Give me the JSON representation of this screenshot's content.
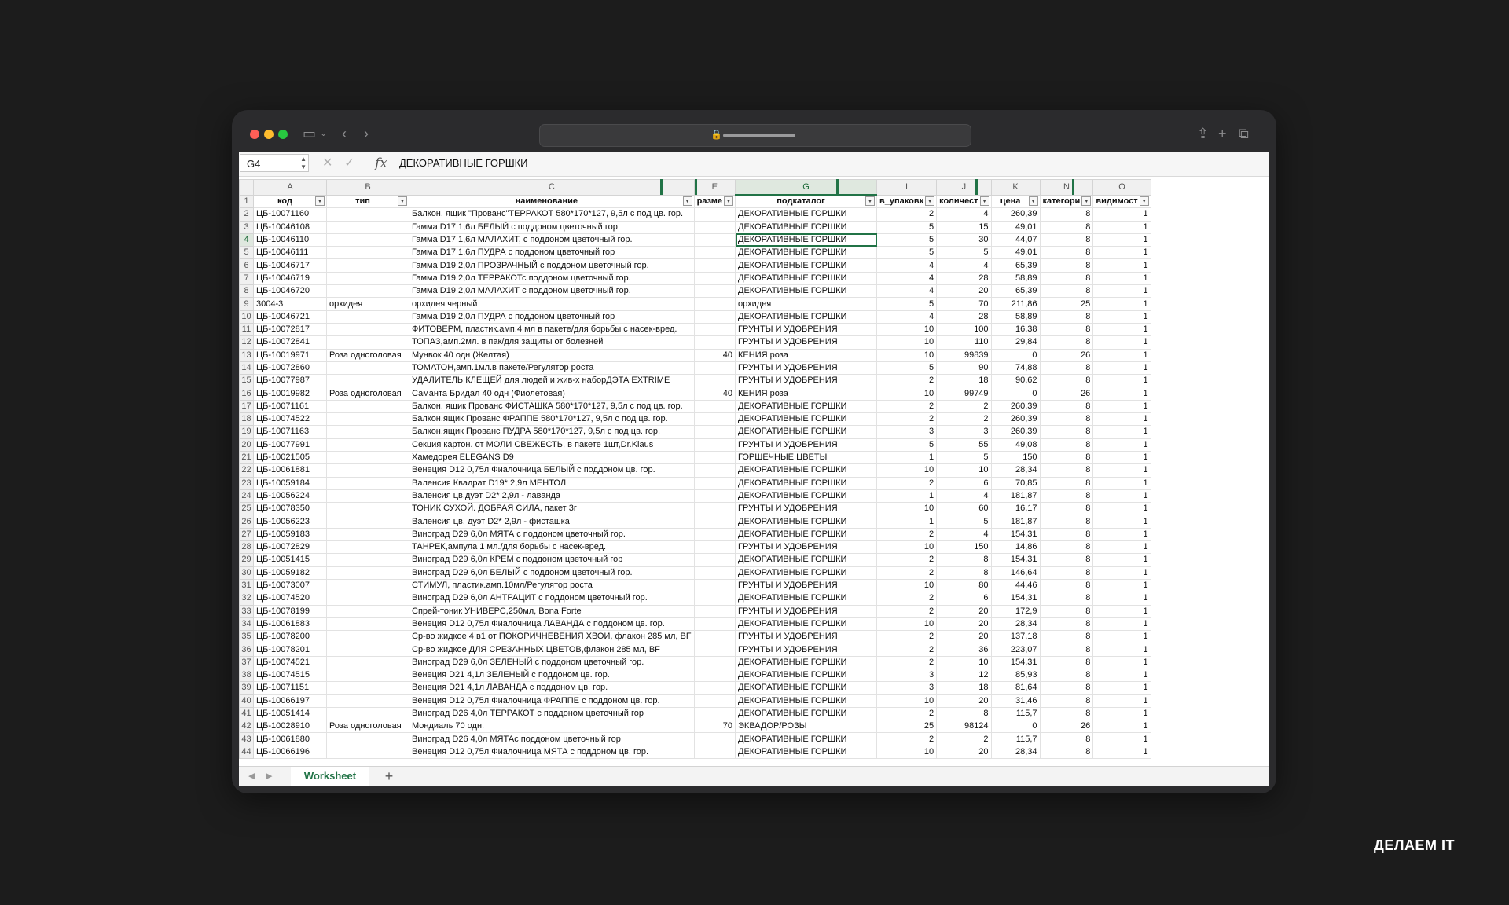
{
  "browser": {
    "icons": [
      "sidebar-icon",
      "chevron-down-icon",
      "back-icon",
      "forward-icon",
      "lock-icon",
      "share-icon",
      "new-tab-icon",
      "tabs-overview-icon"
    ]
  },
  "formula_bar": {
    "cell_ref": "G4",
    "fx_label": "fx",
    "value": "ДЕКОРАТИВНЫЕ ГОРШКИ"
  },
  "sheet": {
    "columns": [
      "A",
      "B",
      "C",
      "E",
      "G",
      "I",
      "J",
      "K",
      "N",
      "O"
    ],
    "headers": [
      "код",
      "тип",
      "наименование",
      "разме",
      "подкаталог",
      "в_упаковк",
      "количест",
      "цена",
      "категори",
      "видимост"
    ],
    "rows": [
      [
        "2",
        "ЦБ-10071160",
        "",
        "Балкон. ящик \"Прованс\"ТЕРРАКОТ 580*170*127, 9,5л с под цв. гор.",
        "",
        "ДЕКОРАТИВНЫЕ ГОРШКИ",
        "2",
        "4",
        "260,39",
        "8",
        "1"
      ],
      [
        "3",
        "ЦБ-10046108",
        "",
        "Гамма D17 1,6л БЕЛЫЙ с поддоном цветочный гор",
        "",
        "ДЕКОРАТИВНЫЕ ГОРШКИ",
        "5",
        "15",
        "49,01",
        "8",
        "1"
      ],
      [
        "4",
        "ЦБ-10046110",
        "",
        "Гамма D17 1,6л МАЛАХИТ, с поддоном цветочный гор.",
        "",
        "ДЕКОРАТИВНЫЕ ГОРШКИ",
        "5",
        "30",
        "44,07",
        "8",
        "1"
      ],
      [
        "5",
        "ЦБ-10046111",
        "",
        "Гамма D17 1,6л ПУДРА с поддоном цветочный гор",
        "",
        "ДЕКОРАТИВНЫЕ ГОРШКИ",
        "5",
        "5",
        "49,01",
        "8",
        "1"
      ],
      [
        "6",
        "ЦБ-10046717",
        "",
        "Гамма D19 2,0л ПРОЗРАЧНЫЙ с поддоном цветочный гор.",
        "",
        "ДЕКОРАТИВНЫЕ ГОРШКИ",
        "4",
        "4",
        "65,39",
        "8",
        "1"
      ],
      [
        "7",
        "ЦБ-10046719",
        "",
        "Гамма D19 2,0л ТЕРРАКОТс поддоном цветочный гор.",
        "",
        "ДЕКОРАТИВНЫЕ ГОРШКИ",
        "4",
        "28",
        "58,89",
        "8",
        "1"
      ],
      [
        "8",
        "ЦБ-10046720",
        "",
        "Гамма D19 2,0л МАЛАХИТ с поддоном цветочный гор.",
        "",
        "ДЕКОРАТИВНЫЕ ГОРШКИ",
        "4",
        "20",
        "65,39",
        "8",
        "1"
      ],
      [
        "9",
        "3004-3",
        "орхидея",
        "орхидея черный",
        "",
        "орхидея",
        "5",
        "70",
        "211,86",
        "25",
        "1"
      ],
      [
        "10",
        "ЦБ-10046721",
        "",
        "Гамма D19 2,0л ПУДРА с поддоном цветочный гор",
        "",
        "ДЕКОРАТИВНЫЕ ГОРШКИ",
        "4",
        "28",
        "58,89",
        "8",
        "1"
      ],
      [
        "11",
        "ЦБ-10072817",
        "",
        "ФИТОВЕРМ, пластик.амп.4 мл в пакете/для борьбы с насек-вред.",
        "",
        "ГРУНТЫ И УДОБРЕНИЯ",
        "10",
        "100",
        "16,38",
        "8",
        "1"
      ],
      [
        "12",
        "ЦБ-10072841",
        "",
        "ТОПАЗ,амп.2мл. в пак/для защиты от болезней",
        "",
        "ГРУНТЫ И УДОБРЕНИЯ",
        "10",
        "110",
        "29,84",
        "8",
        "1"
      ],
      [
        "13",
        "ЦБ-10019971",
        "Роза одноголовая",
        "Мунвок 40 одн (Желтая)",
        "40",
        "КЕНИЯ роза",
        "10",
        "99839",
        "0",
        "26",
        "1"
      ],
      [
        "14",
        "ЦБ-10072860",
        "",
        "ТОМАТОН,амп.1мл.в пакете/Регулятор роста",
        "",
        "ГРУНТЫ И УДОБРЕНИЯ",
        "5",
        "90",
        "74,88",
        "8",
        "1"
      ],
      [
        "15",
        "ЦБ-10077987",
        "",
        "УДАЛИТЕЛЬ КЛЕЩЕЙ для людей и жив-х наборДЭТА EXTRIME",
        "",
        "ГРУНТЫ И УДОБРЕНИЯ",
        "2",
        "18",
        "90,62",
        "8",
        "1"
      ],
      [
        "16",
        "ЦБ-10019982",
        "Роза одноголовая",
        "Саманта Бридал 40 одн (Фиолетовая)",
        "40",
        "КЕНИЯ роза",
        "10",
        "99749",
        "0",
        "26",
        "1"
      ],
      [
        "17",
        "ЦБ-10071161",
        "",
        "Балкон. ящик Прованс ФИСТАШКА 580*170*127, 9,5л с под цв. гор.",
        "",
        "ДЕКОРАТИВНЫЕ ГОРШКИ",
        "2",
        "2",
        "260,39",
        "8",
        "1"
      ],
      [
        "18",
        "ЦБ-10074522",
        "",
        "Балкон.ящик Прованс ФРАППЕ 580*170*127, 9,5л с под цв. гор.",
        "",
        "ДЕКОРАТИВНЫЕ ГОРШКИ",
        "2",
        "2",
        "260,39",
        "8",
        "1"
      ],
      [
        "19",
        "ЦБ-10071163",
        "",
        "Балкон.ящик Прованс ПУДРА 580*170*127, 9,5л с под цв. гор.",
        "",
        "ДЕКОРАТИВНЫЕ ГОРШКИ",
        "3",
        "3",
        "260,39",
        "8",
        "1"
      ],
      [
        "20",
        "ЦБ-10077991",
        "",
        "Секция картон. от МОЛИ СВЕЖЕСТЬ, в пакете 1шт,Dr.Klaus",
        "",
        "ГРУНТЫ И УДОБРЕНИЯ",
        "5",
        "55",
        "49,08",
        "8",
        "1"
      ],
      [
        "21",
        "ЦБ-10021505",
        "",
        "Хамедорея ELEGANS D9",
        "",
        "ГОРШЕЧНЫЕ ЦВЕТЫ",
        "1",
        "5",
        "150",
        "8",
        "1"
      ],
      [
        "22",
        "ЦБ-10061881",
        "",
        "Венеция D12 0,75л Фиалочница БЕЛЫЙ с поддоном цв. гор.",
        "",
        "ДЕКОРАТИВНЫЕ ГОРШКИ",
        "10",
        "10",
        "28,34",
        "8",
        "1"
      ],
      [
        "23",
        "ЦБ-10059184",
        "",
        "Валенсия Квадрат D19* 2,9л МЕНТОЛ",
        "",
        "ДЕКОРАТИВНЫЕ ГОРШКИ",
        "2",
        "6",
        "70,85",
        "8",
        "1"
      ],
      [
        "24",
        "ЦБ-10056224",
        "",
        "Валенсия цв.дуэт D2* 2,9л - лаванда",
        "",
        "ДЕКОРАТИВНЫЕ ГОРШКИ",
        "1",
        "4",
        "181,87",
        "8",
        "1"
      ],
      [
        "25",
        "ЦБ-10078350",
        "",
        "ТОНИК СУХОЙ. ДОБРАЯ СИЛА, пакет 3г",
        "",
        "ГРУНТЫ И УДОБРЕНИЯ",
        "10",
        "60",
        "16,17",
        "8",
        "1"
      ],
      [
        "26",
        "ЦБ-10056223",
        "",
        "Валенсия цв. дуэт D2* 2,9л - фисташка",
        "",
        "ДЕКОРАТИВНЫЕ ГОРШКИ",
        "1",
        "5",
        "181,87",
        "8",
        "1"
      ],
      [
        "27",
        "ЦБ-10059183",
        "",
        "Виноград D29 6,0л МЯТА с поддоном цветочный гор.",
        "",
        "ДЕКОРАТИВНЫЕ ГОРШКИ",
        "2",
        "4",
        "154,31",
        "8",
        "1"
      ],
      [
        "28",
        "ЦБ-10072829",
        "",
        "ТАНРЕК,ампула 1 мл./для борьбы с насек-вред.",
        "",
        "ГРУНТЫ И УДОБРЕНИЯ",
        "10",
        "150",
        "14,86",
        "8",
        "1"
      ],
      [
        "29",
        "ЦБ-10051415",
        "",
        "Виноград D29 6,0л КРЕМ с поддоном цветочный гор",
        "",
        "ДЕКОРАТИВНЫЕ ГОРШКИ",
        "2",
        "8",
        "154,31",
        "8",
        "1"
      ],
      [
        "30",
        "ЦБ-10059182",
        "",
        "Виноград D29 6,0л БЕЛЫЙ с поддоном цветочный гор.",
        "",
        "ДЕКОРАТИВНЫЕ ГОРШКИ",
        "2",
        "8",
        "146,64",
        "8",
        "1"
      ],
      [
        "31",
        "ЦБ-10073007",
        "",
        "СТИМУЛ, пластик.амп.10мл/Регулятор роста",
        "",
        "ГРУНТЫ И УДОБРЕНИЯ",
        "10",
        "80",
        "44,46",
        "8",
        "1"
      ],
      [
        "32",
        "ЦБ-10074520",
        "",
        "Виноград D29 6,0л АНТРАЦИТ с поддоном цветочный гор.",
        "",
        "ДЕКОРАТИВНЫЕ ГОРШКИ",
        "2",
        "6",
        "154,31",
        "8",
        "1"
      ],
      [
        "33",
        "ЦБ-10078199",
        "",
        "Спрей-тоник УНИВЕРС,250мл, Bona Forte",
        "",
        "ГРУНТЫ И УДОБРЕНИЯ",
        "2",
        "20",
        "172,9",
        "8",
        "1"
      ],
      [
        "34",
        "ЦБ-10061883",
        "",
        "Венеция D12 0,75л Фиалочница ЛАВАНДА с поддоном цв. гор.",
        "",
        "ДЕКОРАТИВНЫЕ ГОРШКИ",
        "10",
        "20",
        "28,34",
        "8",
        "1"
      ],
      [
        "35",
        "ЦБ-10078200",
        "",
        "Ср-во жидкое 4 в1 от ПОКОРИЧНЕВЕНИЯ ХВОИ, флакон 285 мл, BF",
        "",
        "ГРУНТЫ И УДОБРЕНИЯ",
        "2",
        "20",
        "137,18",
        "8",
        "1"
      ],
      [
        "36",
        "ЦБ-10078201",
        "",
        "Ср-во жидкое ДЛЯ СРЕЗАННЫХ ЦВЕТОВ,флакон 285 мл, BF",
        "",
        "ГРУНТЫ И УДОБРЕНИЯ",
        "2",
        "36",
        "223,07",
        "8",
        "1"
      ],
      [
        "37",
        "ЦБ-10074521",
        "",
        "Виноград D29 6,0л ЗЕЛЕНЫЙ с поддоном цветочный гор.",
        "",
        "ДЕКОРАТИВНЫЕ ГОРШКИ",
        "2",
        "10",
        "154,31",
        "8",
        "1"
      ],
      [
        "38",
        "ЦБ-10074515",
        "",
        "Венеция D21 4,1л ЗЕЛЕНЫЙ с поддоном цв. гор.",
        "",
        "ДЕКОРАТИВНЫЕ ГОРШКИ",
        "3",
        "12",
        "85,93",
        "8",
        "1"
      ],
      [
        "39",
        "ЦБ-10071151",
        "",
        "Венеция D21 4,1л ЛАВАНДА с поддоном цв. гор.",
        "",
        "ДЕКОРАТИВНЫЕ ГОРШКИ",
        "3",
        "18",
        "81,64",
        "8",
        "1"
      ],
      [
        "40",
        "ЦБ-10066197",
        "",
        "Венеция D12 0,75л Фиалочница ФРАППЕ с поддоном цв. гор.",
        "",
        "ДЕКОРАТИВНЫЕ ГОРШКИ",
        "10",
        "20",
        "31,46",
        "8",
        "1"
      ],
      [
        "41",
        "ЦБ-10051414",
        "",
        "Виноград D26 4,0л ТЕРРАКОТ с поддоном цветочный гор",
        "",
        "ДЕКОРАТИВНЫЕ ГОРШКИ",
        "2",
        "8",
        "115,7",
        "8",
        "1"
      ],
      [
        "42",
        "ЦБ-10028910",
        "Роза одноголовая",
        "Мондиаль 70 одн.",
        "70",
        "ЭКВАДОР/РОЗЫ",
        "25",
        "98124",
        "0",
        "26",
        "1"
      ],
      [
        "43",
        "ЦБ-10061880",
        "",
        "Виноград D26 4,0л МЯТАс поддоном цветочный гор",
        "",
        "ДЕКОРАТИВНЫЕ ГОРШКИ",
        "2",
        "2",
        "115,7",
        "8",
        "1"
      ],
      [
        "44",
        "ЦБ-10066196",
        "",
        "Венеция D12 0,75л Фиалочница МЯТА с поддоном цв. гор.",
        "",
        "ДЕКОРАТИВНЫЕ ГОРШКИ",
        "10",
        "20",
        "28,34",
        "8",
        "1"
      ]
    ],
    "active_cell": {
      "row": "4",
      "col": "G"
    },
    "tab_name": "Worksheet",
    "add_tab": "+"
  },
  "branding": {
    "logo_text": "ДЕЛАЕМ IT"
  },
  "colors": {
    "accent": "#217346",
    "background": "#1c1c1c"
  }
}
